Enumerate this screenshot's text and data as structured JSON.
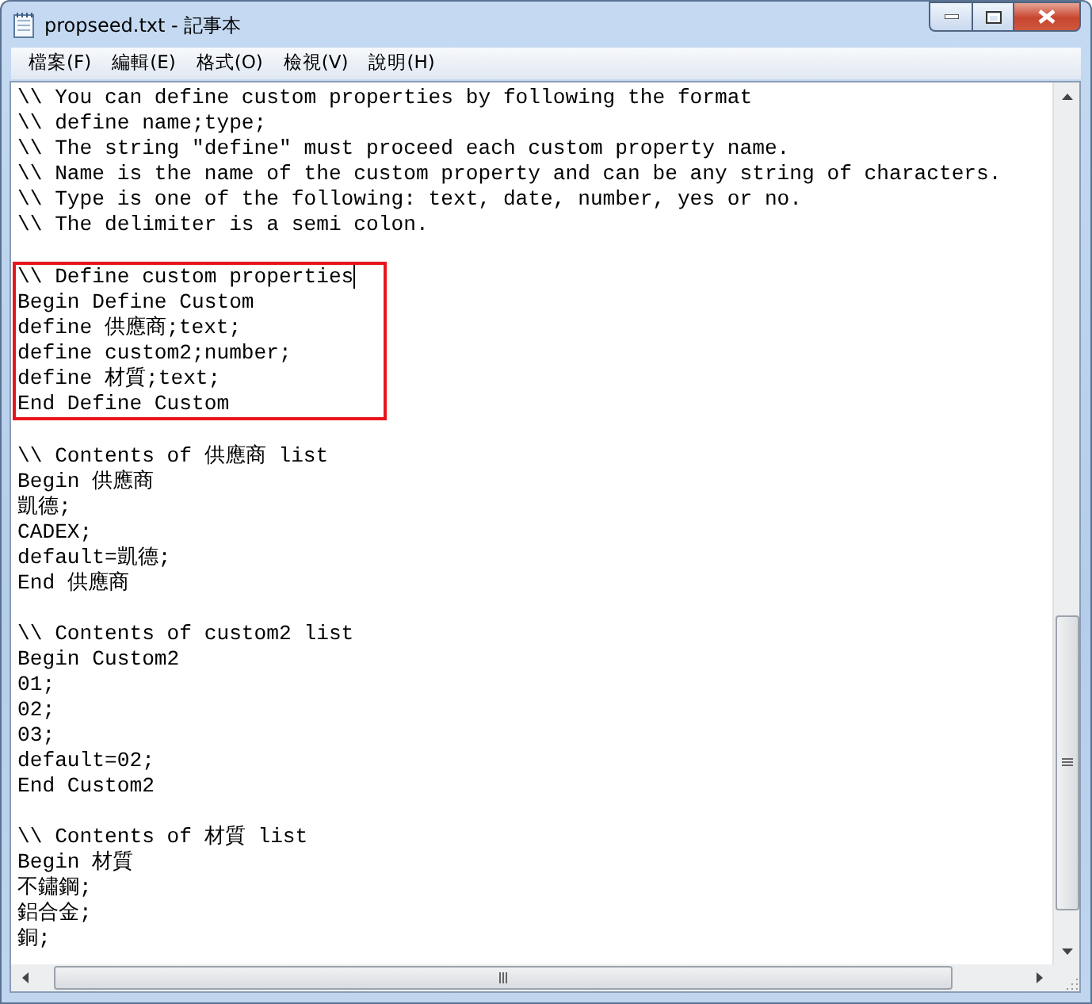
{
  "window": {
    "title": "propseed.txt - 記事本"
  },
  "menu": [
    "檔案(F)",
    "編輯(E)",
    "格式(O)",
    "檢視(V)",
    "說明(H)"
  ],
  "document": {
    "blocks": [
      {
        "highlighted": false,
        "lines": [
          {
            "text": "\\\\ You can define custom properties by following the format",
            "caret": false
          },
          {
            "text": "\\\\ define name;type;",
            "caret": false
          },
          {
            "text": "\\\\ The string \"define\" must proceed each custom property name.",
            "caret": false
          },
          {
            "text": "\\\\ Name is the name of the custom property and can be any string of characters.",
            "caret": false
          },
          {
            "text": "\\\\ Type is one of the following: text, date, number, yes or no.",
            "caret": false
          },
          {
            "text": "\\\\ The delimiter is a semi colon.",
            "caret": false
          }
        ]
      },
      {
        "highlighted": true,
        "lines": [
          {
            "text": "\\\\ Define custom properties",
            "caret": true
          },
          {
            "text": "Begin Define Custom",
            "caret": false
          },
          {
            "text": "define 供應商;text;",
            "caret": false
          },
          {
            "text": "define custom2;number;",
            "caret": false
          },
          {
            "text": "define 材質;text;",
            "caret": false
          },
          {
            "text": "End Define Custom",
            "caret": false
          }
        ]
      },
      {
        "highlighted": false,
        "lines": [
          {
            "text": "\\\\ Contents of 供應商 list",
            "caret": false
          },
          {
            "text": "Begin 供應商",
            "caret": false
          },
          {
            "text": "凱德;",
            "caret": false
          },
          {
            "text": "CADEX;",
            "caret": false
          },
          {
            "text": "default=凱德;",
            "caret": false
          },
          {
            "text": "End 供應商",
            "caret": false
          }
        ]
      },
      {
        "highlighted": false,
        "lines": [
          {
            "text": "\\\\ Contents of custom2 list",
            "caret": false
          },
          {
            "text": "Begin Custom2",
            "caret": false
          },
          {
            "text": "01;",
            "caret": false
          },
          {
            "text": "02;",
            "caret": false
          },
          {
            "text": "03;",
            "caret": false
          },
          {
            "text": "default=02;",
            "caret": false
          },
          {
            "text": "End Custom2",
            "caret": false
          }
        ]
      },
      {
        "highlighted": false,
        "lines": [
          {
            "text": "\\\\ Contents of 材質 list",
            "caret": false
          },
          {
            "text": "Begin 材質",
            "caret": false
          },
          {
            "text": "不鏽鋼;",
            "caret": false
          },
          {
            "text": "鋁合金;",
            "caret": false
          },
          {
            "text": "銅;",
            "caret": false
          }
        ]
      }
    ]
  }
}
